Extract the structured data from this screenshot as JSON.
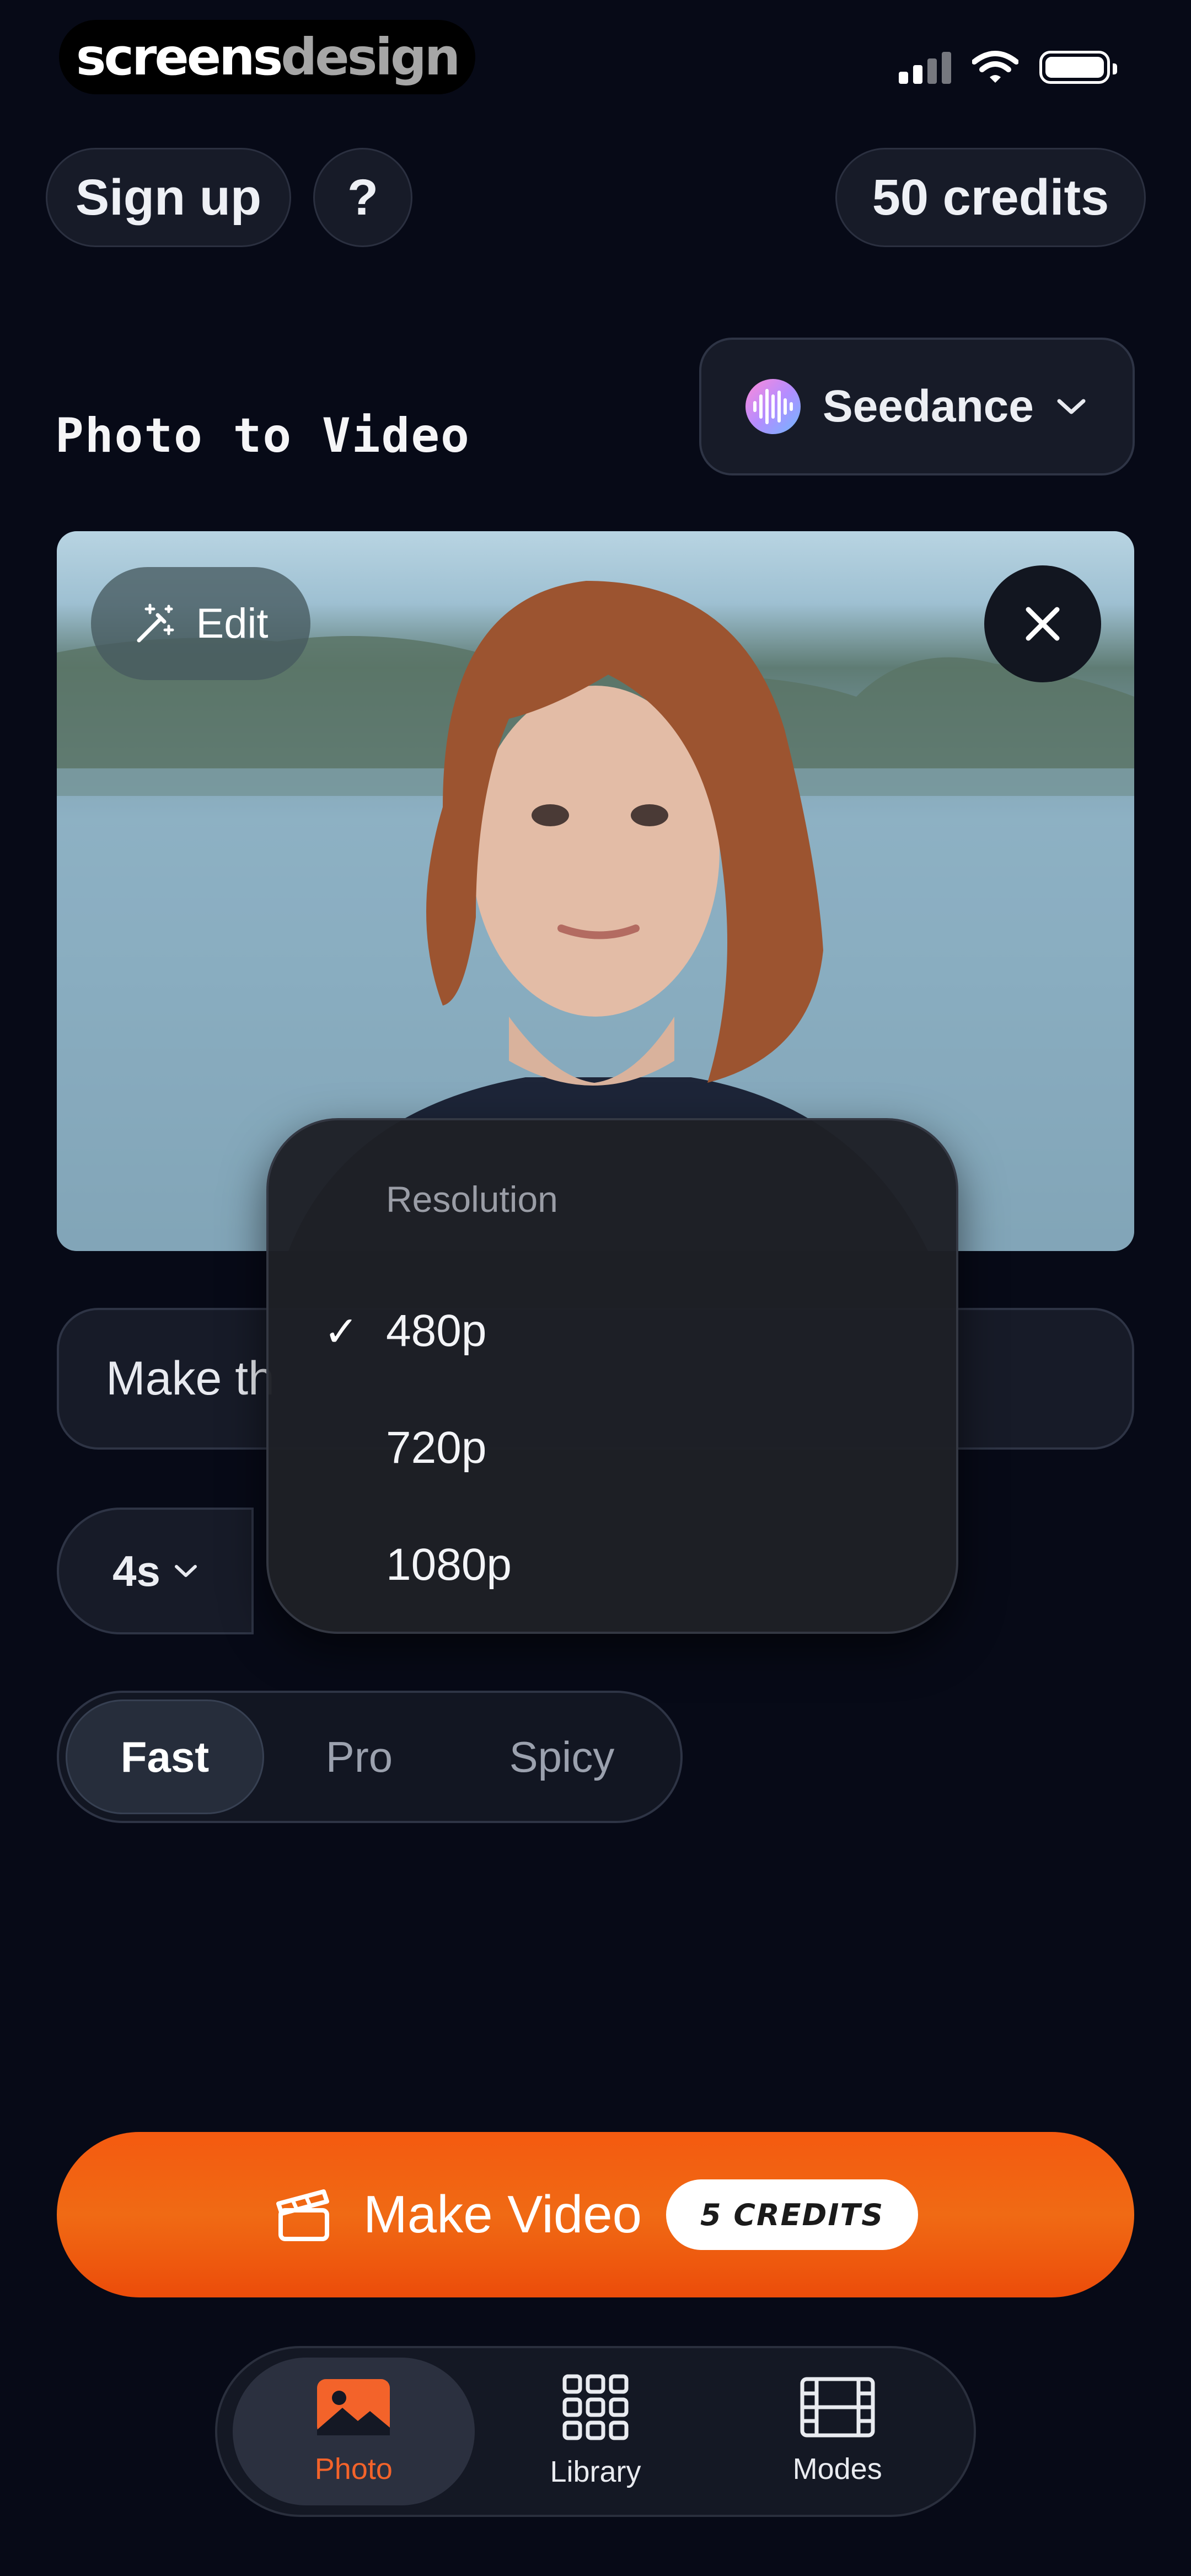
{
  "status_bar": {
    "brand_primary": "screens",
    "brand_secondary": "design",
    "icons": [
      "signal-icon",
      "wifi-icon",
      "battery-icon"
    ]
  },
  "header": {
    "signup_label": "Sign up",
    "help_label": "?",
    "credits_label": "50 credits"
  },
  "page": {
    "title": "Photo to Video",
    "model_name": "Seedance"
  },
  "photo": {
    "edit_label": "Edit",
    "close_icon": "close-icon"
  },
  "prompt": {
    "value": "Make th"
  },
  "duration": {
    "label": "4s"
  },
  "resolution_menu": {
    "header": "Resolution",
    "options": [
      {
        "label": "480p",
        "selected": true
      },
      {
        "label": "720p",
        "selected": false
      },
      {
        "label": "1080p",
        "selected": false
      }
    ]
  },
  "quality": {
    "options": [
      "Fast",
      "Pro",
      "Spicy"
    ],
    "selected": "Fast"
  },
  "action": {
    "make_label": "Make Video",
    "cost_badge": "5 CREDITS"
  },
  "tabs": [
    {
      "label": "Photo",
      "icon": "image-icon",
      "active": true
    },
    {
      "label": "Library",
      "icon": "grid-icon",
      "active": false
    },
    {
      "label": "Modes",
      "icon": "film-icon",
      "active": false
    }
  ],
  "colors": {
    "background": "#070a17",
    "accent": "#f25a10",
    "active_tab": "#f3632a"
  }
}
